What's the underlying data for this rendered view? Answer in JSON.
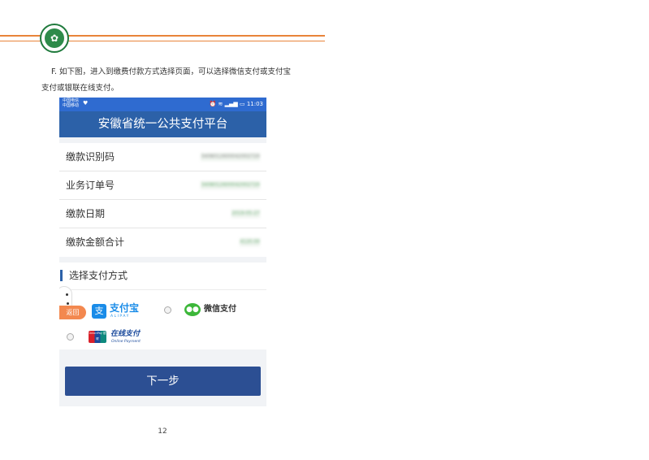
{
  "document": {
    "paragraph_line1": "F. 如下图，进入到缴费付款方式选择页面，可以选择微信支付或支付宝",
    "paragraph_line2": "支付或银联在线支付。",
    "page_number": "12"
  },
  "phone": {
    "status_bar": {
      "carrier_line1": "中国电信",
      "carrier_line2": "中国移动",
      "time": "11:03"
    },
    "title": "安徽省统一公共支付平台",
    "rows": [
      {
        "label": "缴款识别码",
        "value": "3408012600042002720"
      },
      {
        "label": "业务订单号",
        "value": "3408012600042002720"
      },
      {
        "label": "缴款日期",
        "value": "2019-05-27"
      },
      {
        "label": "缴款金额合计",
        "value": "4120.00"
      }
    ],
    "payment_section_title": "选择支付方式",
    "methods": {
      "alipay_name": "支付宝",
      "alipay_en": "ALIPAY",
      "wechat_name": "微信支付",
      "unionpay_logo_text": "UnionPay 银联",
      "unionpay_name": "在线支付",
      "unionpay_en": "Online Payment"
    },
    "back_label": "返回",
    "next_button": "下一步"
  },
  "colors": {
    "accent_orange": "#e8843a",
    "title_blue": "#2c61a8",
    "button_blue": "#2c4f93",
    "alipay_blue": "#1a8ce8",
    "wechat_green": "#3db73a"
  }
}
